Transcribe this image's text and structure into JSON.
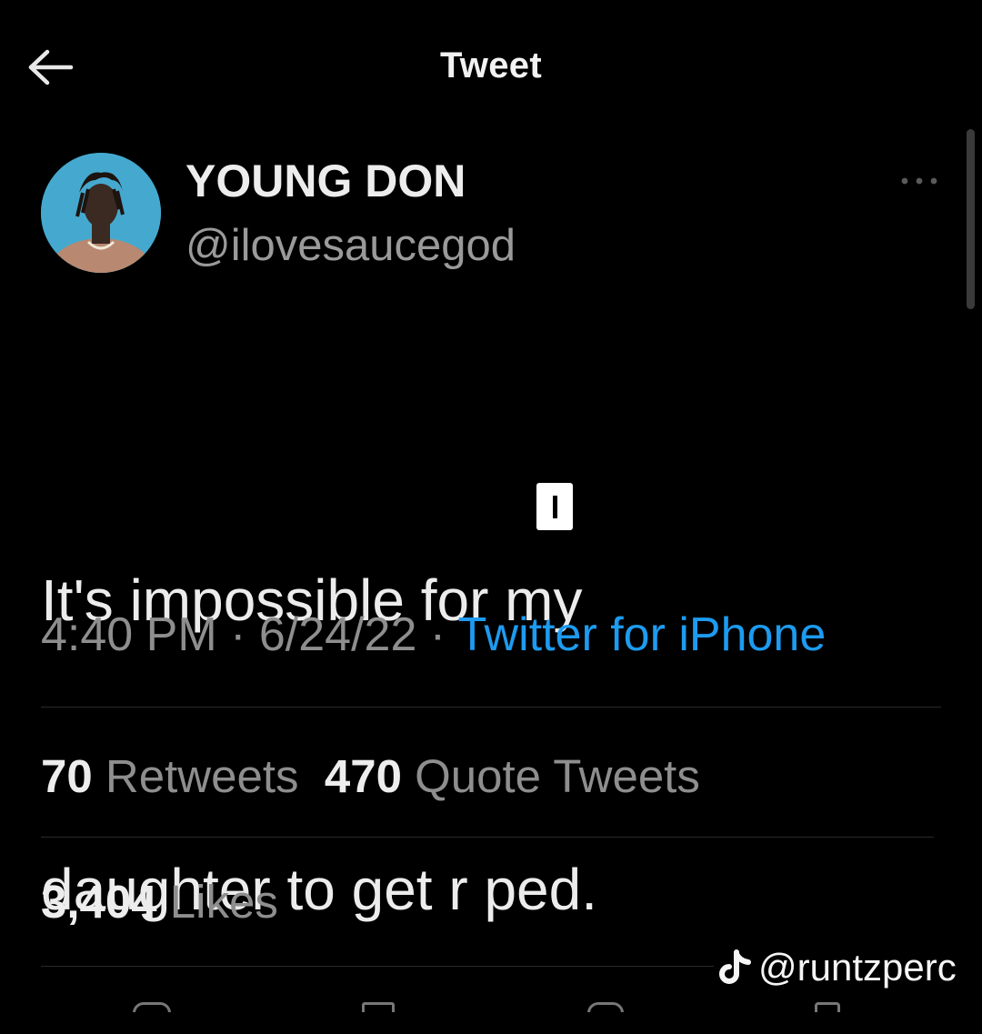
{
  "header": {
    "title": "Tweet",
    "back_icon": "arrow-left-icon"
  },
  "tweet": {
    "author": {
      "display_name": "YOUNG DON",
      "handle": "@ilovesaucegod"
    },
    "more_icon": "ellipsis-icon",
    "text_line1": "It's impossible for my",
    "text_line2": "daughter to get r ped.",
    "timestamp": "4:40 PM · 6/24/22 · ",
    "source": "Twitter for iPhone",
    "retweets_count": "70",
    "retweets_label": "Retweets",
    "quotes_count": "470",
    "quotes_label": "Quote Tweets",
    "likes_count": "3,404",
    "likes_label": "Likes"
  },
  "watermark": {
    "icon": "tiktok-icon",
    "text": "@runtzperc"
  },
  "colors": {
    "background": "#000000",
    "link": "#1d9bf0",
    "secondary_text": "#8e8e8e",
    "primary_text": "#ececec"
  }
}
